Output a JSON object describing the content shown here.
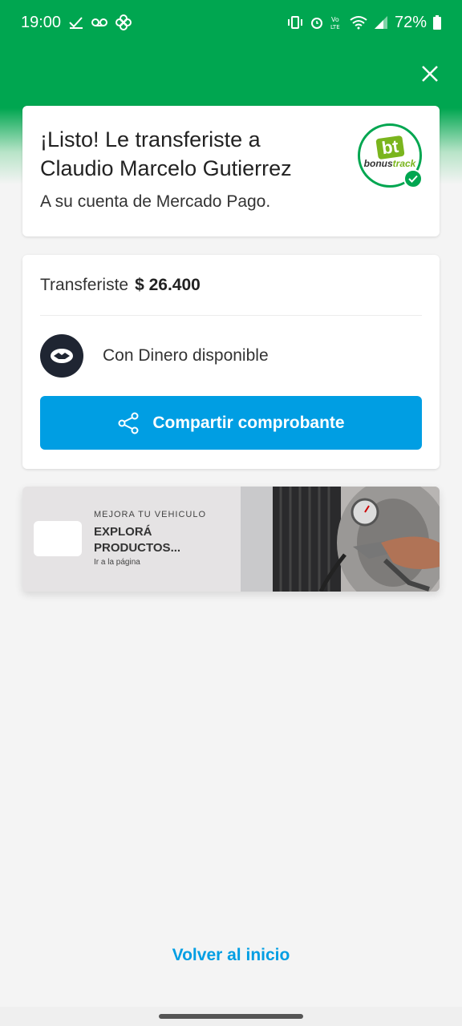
{
  "status_bar": {
    "time": "19:00",
    "battery": "72%"
  },
  "header": {
    "title": "¡Listo! Le transferiste a Claudio Marcelo Gutierrez",
    "subtitle": "A su cuenta de Mercado Pago.",
    "logo": {
      "badge": "bt",
      "brand_prefix": "bonus",
      "brand_suffix": "track"
    }
  },
  "transfer": {
    "amount_label": "Transferiste",
    "amount_value": "$ 26.400",
    "method_label": "Con Dinero disponible",
    "share_label": "Compartir comprobante"
  },
  "banner": {
    "kicker": "MEJORA TU VEHICULO",
    "title": "EXPLORÁ PRODUCTOS...",
    "link": "Ir a la página"
  },
  "footer": {
    "back_label": "Volver al inicio"
  },
  "colors": {
    "green": "#00a650",
    "blue": "#009ee3",
    "dark": "#1f2532"
  }
}
